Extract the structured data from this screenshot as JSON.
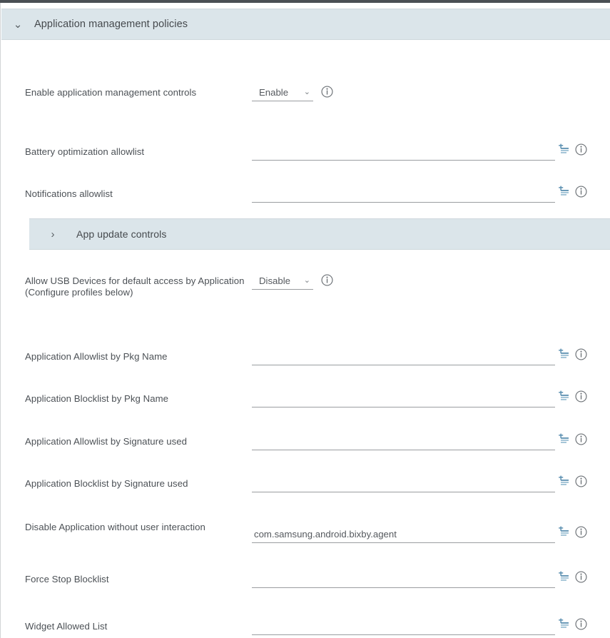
{
  "section": {
    "title": "Application management policies",
    "chevron_icon": "chevron-down-icon",
    "chevron_glyph": "⌄"
  },
  "nested_section": {
    "title": "App update controls",
    "chevron_icon": "chevron-right-icon",
    "chevron_glyph": "›"
  },
  "icons": {
    "list_add": "list-add-icon",
    "info": "info-icon",
    "caret_glyph": "⌄"
  },
  "colors": {
    "header_bg": "#dbe5ea",
    "icon_blue": "#5b8fb0",
    "text": "#4c5156",
    "underline": "#9a9da0",
    "top_strip": "#4a4f54"
  },
  "rows": [
    {
      "label": "Enable application management controls",
      "type": "select",
      "value": "Enable",
      "has_list_icon": false,
      "has_info_icon": true
    },
    {
      "label": "Battery optimization allowlist",
      "type": "text",
      "value": "",
      "has_list_icon": true,
      "has_info_icon": true
    },
    {
      "label": "Notifications allowlist",
      "type": "text",
      "value": "",
      "has_list_icon": true,
      "has_info_icon": true
    },
    {
      "label": "Allow USB Devices for default access by Application (Configure profiles below)",
      "type": "select",
      "value": "Disable",
      "has_list_icon": false,
      "has_info_icon": true
    },
    {
      "label": "Application Allowlist by Pkg Name",
      "type": "text",
      "value": "",
      "has_list_icon": true,
      "has_info_icon": true
    },
    {
      "label": "Application Blocklist by Pkg Name",
      "type": "text",
      "value": "",
      "has_list_icon": true,
      "has_info_icon": true
    },
    {
      "label": "Application Allowlist by Signature used",
      "type": "text",
      "value": "",
      "has_list_icon": true,
      "has_info_icon": true
    },
    {
      "label": "Application Blocklist by Signature used",
      "type": "text",
      "value": "",
      "has_list_icon": true,
      "has_info_icon": true
    },
    {
      "label": "Disable Application without user interaction",
      "type": "text",
      "value": "com.samsung.android.bixby.agent",
      "has_list_icon": true,
      "has_info_icon": true
    },
    {
      "label": "Force Stop Blocklist",
      "type": "text",
      "value": "",
      "has_list_icon": true,
      "has_info_icon": true
    },
    {
      "label": "Widget Allowed List",
      "type": "text",
      "value": "",
      "has_list_icon": true,
      "has_info_icon": true
    }
  ]
}
